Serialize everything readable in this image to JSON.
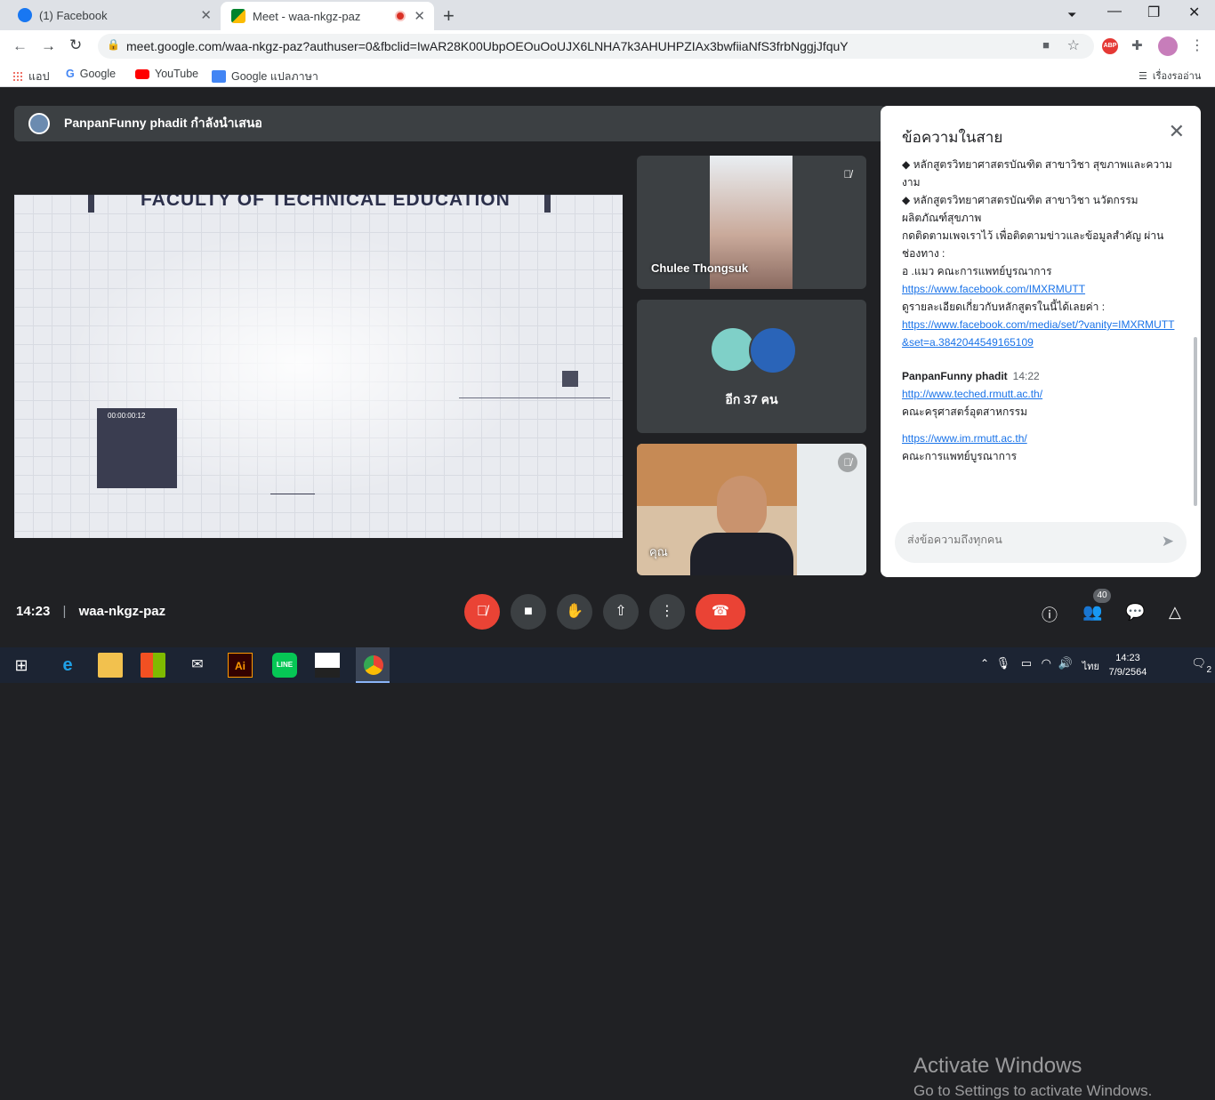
{
  "browser": {
    "tabs": [
      {
        "title": "(1) Facebook",
        "favicon": "facebook-icon"
      },
      {
        "title": "Meet - waa-nkgz-paz",
        "favicon": "meet-icon",
        "recording": true
      }
    ],
    "url": "meet.google.com/waa-nkgz-paz?authuser=0&fbclid=IwAR28K00UbpOEOuOoUJX6LNHA7k3AHUHPZIAx3bwfiiaNfS3frbNggjJfquY",
    "bookmarks": [
      "แอป",
      "Google",
      "YouTube",
      "Google แปลภาษา"
    ],
    "reading_list": "เรื่องรออ่าน"
  },
  "meet": {
    "presenter_banner": "PanpanFunny phadit กำลังนำเสนอ",
    "slide_title": "FACULTY OF TECHNICAL EDUCATION",
    "slide_timer": "00:00:00:12",
    "tiles": [
      {
        "name": "Chulee Thongsuk"
      },
      {
        "name": "อีก 37 คน"
      },
      {
        "name": "คุณ"
      }
    ],
    "meeting_time": "14:23",
    "meeting_code": "waa-nkgz-paz",
    "participant_count": "40"
  },
  "chat": {
    "title": "ข้อความในสาย",
    "lines": [
      {
        "text": "◆ หลักสูตรวิทยาศาสตรบัณฑิต สาขาวิชา สุขภาพและความงาม"
      },
      {
        "text": "◆ หลักสูตรวิทยาศาสตรบัณฑิต สาขาวิชา นวัตกรรมผลิตภัณฑ์สุขภาพ"
      },
      {
        "text": "กดติดตามเพจเราไว้ เพื่อติดตามข่าวและข้อมูลสำคัญ ผ่านช่องทาง :"
      },
      {
        "text": "อ .แมว คณะการแพทย์บูรณาการ"
      }
    ],
    "link1": "https://www.facebook.com/IMXRMUTT",
    "line_detail": "ดูรายละเอียดเกี่ยวกับหลักสูตรในนี้ได้เลยค่า :",
    "link2": "https://www.facebook.com/media/set/?vanity=IMXRMUTT&set=a.3842044549165109",
    "msg2_sender": "PanpanFunny phadit",
    "msg2_time": "14:22",
    "msg2_link1": "http://www.teched.rmutt.ac.th/",
    "msg2_text1": "คณะครุศาสตร์อุตสาหกรรม",
    "msg2_link2": "https://www.im.rmutt.ac.th/",
    "msg2_text2": "คณะการแพทย์บูรณาการ",
    "input_placeholder": "ส่งข้อความถึงทุกคน"
  },
  "watermark": {
    "line1": "Activate Windows",
    "line2": "Go to Settings to activate Windows."
  },
  "taskbar": {
    "lang": "ไทย",
    "time": "14:23",
    "date": "7/9/2564",
    "notif": "2"
  },
  "colors": {
    "red": "#ea4335",
    "link": "#1a73e8",
    "dark": "#202124"
  }
}
